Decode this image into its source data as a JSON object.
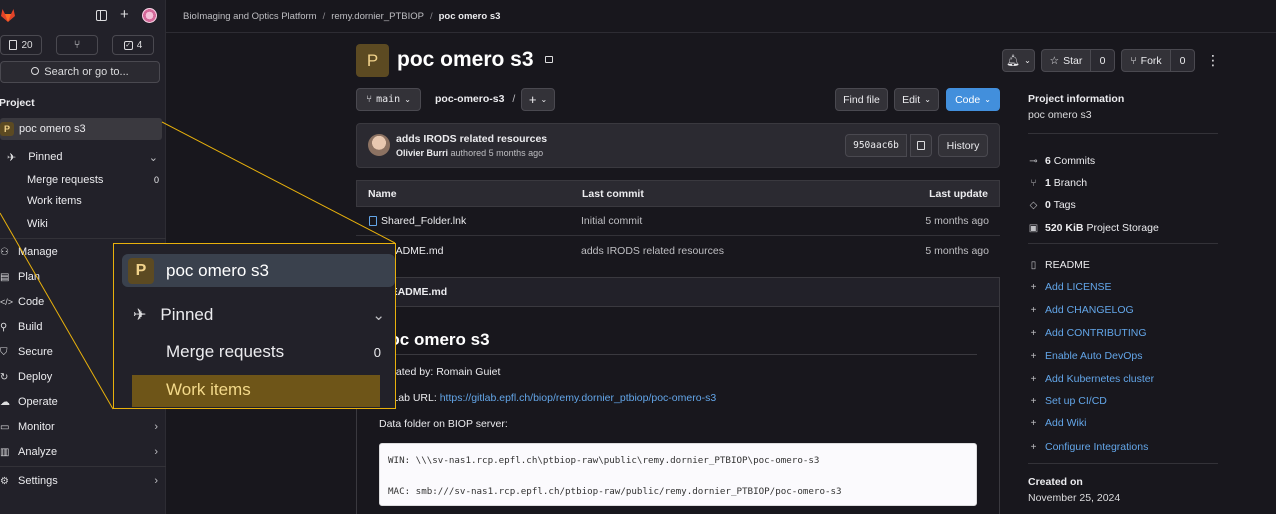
{
  "sidebar": {
    "counts": {
      "issues": "20",
      "todos": "4"
    },
    "search_label": "Search or go to...",
    "section_title": "Project",
    "project_name": "poc omero s3",
    "project_initial": "P",
    "pinned_label": "Pinned",
    "pinned_items": [
      {
        "label": "Merge requests",
        "count": "0"
      },
      {
        "label": "Work items"
      },
      {
        "label": "Wiki"
      }
    ],
    "menu": [
      "Manage",
      "Plan",
      "Code",
      "Build",
      "Secure",
      "Deploy",
      "Operate",
      "Monitor",
      "Analyze",
      "Settings"
    ]
  },
  "breadcrumb": [
    "BioImaging and Optics Platform",
    "remy.dornier_PTBIOP",
    "poc omero s3"
  ],
  "project": {
    "initial": "P",
    "title": "poc omero s3",
    "star_label": "Star",
    "star_count": "0",
    "fork_label": "Fork",
    "fork_count": "0"
  },
  "repo_bar": {
    "branch": "main",
    "path": "poc-omero-s3",
    "path_sep": "/",
    "find_file": "Find file",
    "edit": "Edit",
    "code": "Code"
  },
  "last_commit": {
    "message": "adds IRODS related resources",
    "author": "Olivier Burri",
    "meta": "authored 5 months ago",
    "sha": "950aac6b",
    "history": "History"
  },
  "files": {
    "headers": [
      "Name",
      "Last commit",
      "Last update"
    ],
    "rows": [
      {
        "name": "Shared_Folder.lnk",
        "commit": "Initial commit",
        "updated": "5 months ago"
      },
      {
        "name": "README.md",
        "commit": "adds IRODS related resources",
        "updated": "5 months ago"
      }
    ]
  },
  "readme": {
    "filename": "README.md",
    "heading": "poc omero s3",
    "created_by": "Created by: Romain Guiet",
    "gitlab_url_label": "GitLab URL:",
    "gitlab_url": "https://gitlab.epfl.ch/biop/remy.dornier_ptbiop/poc-omero-s3",
    "data_folder": "Data folder on BIOP server:",
    "win_path": "WIN: \\\\\\sv-nas1.rcp.epfl.ch\\ptbiop-raw\\public\\remy.dornier_PTBIOP\\poc-omero-s3",
    "mac_path": "MAC: smb:///sv-nas1.rcp.epfl.ch/ptbiop-raw/public/remy.dornier_PTBIOP/poc-omero-s3"
  },
  "info": {
    "title": "Project information",
    "subtitle": "poc omero s3",
    "stats": [
      {
        "num": "6",
        "label": "Commits"
      },
      {
        "num": "1",
        "label": "Branch"
      },
      {
        "num": "0",
        "label": "Tags"
      },
      {
        "num": "520 KiB",
        "label": "Project Storage"
      }
    ],
    "readme": "README",
    "actions": [
      "Add LICENSE",
      "Add CHANGELOG",
      "Add CONTRIBUTING",
      "Enable Auto DevOps",
      "Add Kubernetes cluster",
      "Set up CI/CD",
      "Add Wiki",
      "Configure Integrations"
    ],
    "created_on_label": "Created on",
    "created_on": "November 25, 2024"
  },
  "colors": {
    "accent": "#428fdc",
    "zoom_border": "#e8b10c",
    "project_badge": "#5c4a22"
  }
}
